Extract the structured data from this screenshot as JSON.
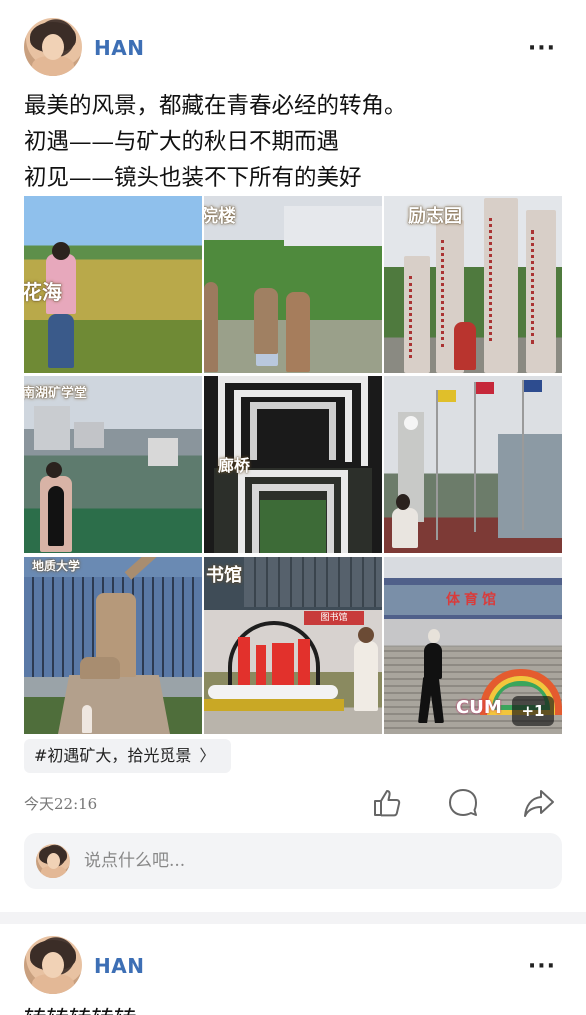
{
  "post": {
    "username": "HAN",
    "more_label": "···",
    "lines": [
      "最美的风景，都藏在青春必经的转角。",
      "初遇——与矿大的秋日不期而遇",
      "初见——镜头也装不下所有的美好"
    ],
    "images": [
      {
        "caption": "花海",
        "icon": "photo-flower-field"
      },
      {
        "caption": "院楼",
        "icon": "photo-statues"
      },
      {
        "caption": "励志园",
        "icon": "photo-stone-pillars"
      },
      {
        "caption": "南湖矿学堂",
        "icon": "photo-lake"
      },
      {
        "caption": "廊桥",
        "icon": "photo-arch-bridge"
      },
      {
        "caption": "",
        "icon": "photo-clock-tower"
      },
      {
        "caption": "地质大学",
        "icon": "photo-miner-statue"
      },
      {
        "caption": "书馆",
        "icon": "photo-library"
      },
      {
        "caption": "",
        "icon": "photo-gym"
      }
    ],
    "sign_library": "图书馆",
    "sign_gym": "体育馆",
    "cum_logo": "CUM",
    "extra_count": "+1",
    "topic": "#初遇矿大，拾光觅景",
    "topic_chevron": "〉",
    "time": "今天22:16",
    "comment_placeholder": "说点什么吧..."
  },
  "post2": {
    "username": "HAN",
    "more_label": "···",
    "text_partial": "转转转转转"
  },
  "colors": {
    "username": "#3d6fb5",
    "background": "#ffffff",
    "divider": "#f3f3f5",
    "comment_bar": "#f3f4f6"
  }
}
